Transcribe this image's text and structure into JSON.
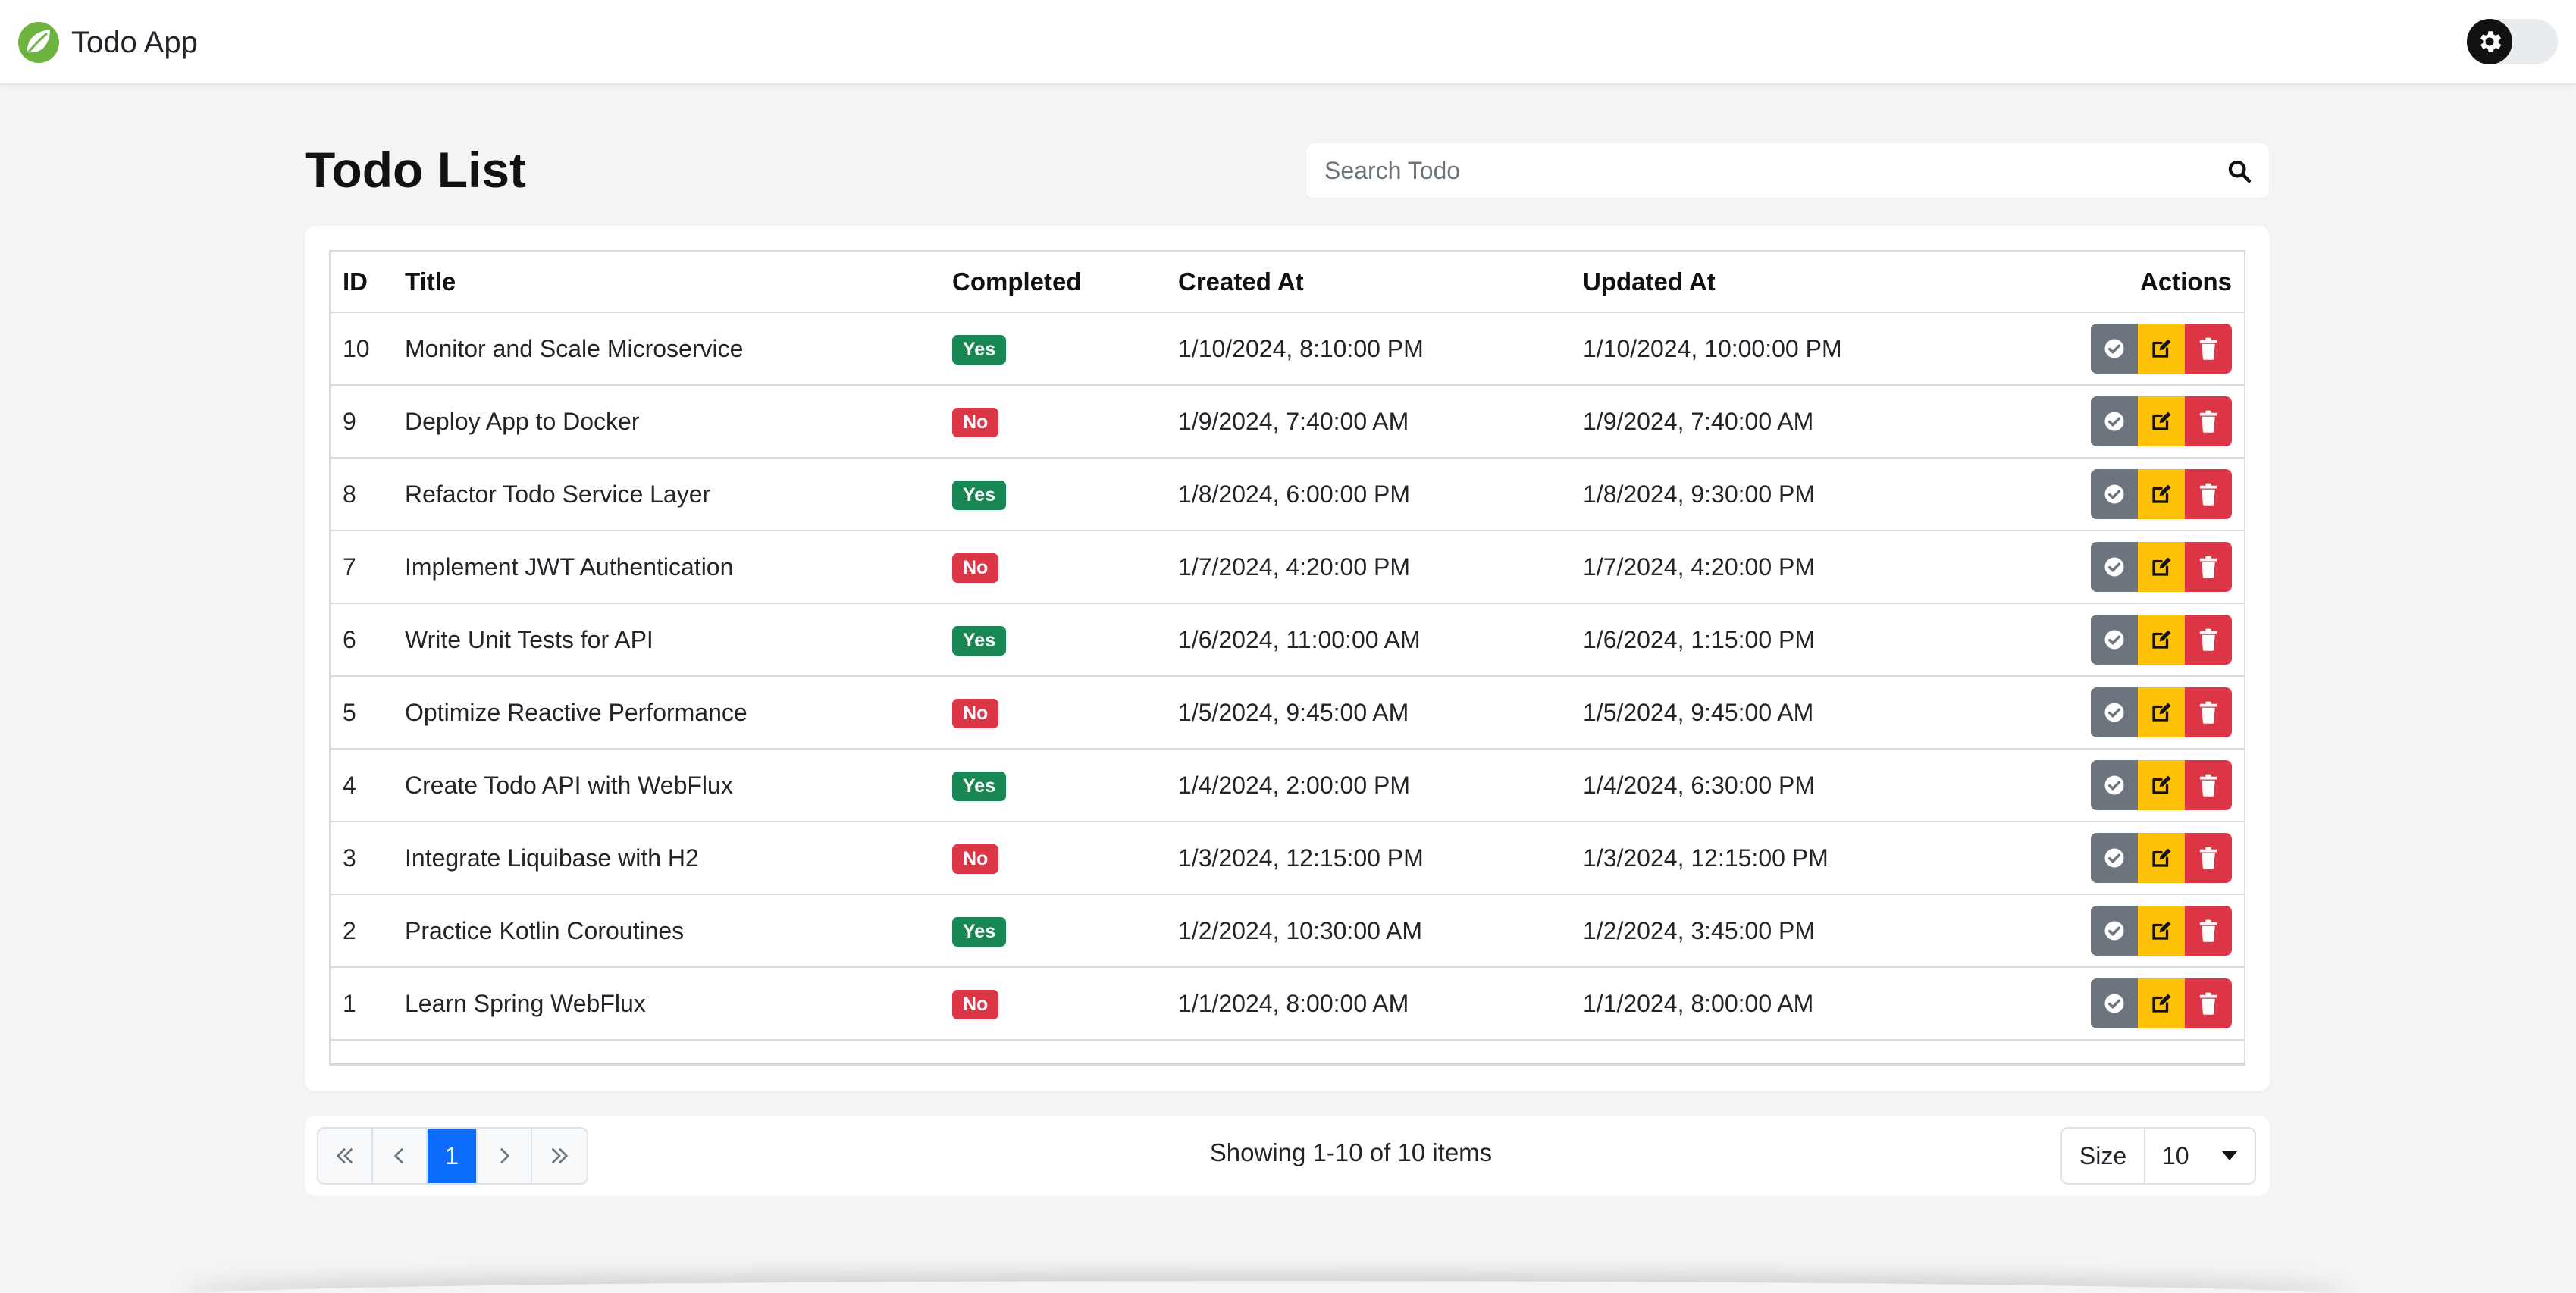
{
  "navbar": {
    "brand": "Todo App",
    "logo_icon": "spring-leaf-icon",
    "theme_icon": "gear-icon"
  },
  "page": {
    "title": "Todo List"
  },
  "search": {
    "placeholder": "Search Todo",
    "value": "",
    "icon": "search-icon"
  },
  "table": {
    "headers": {
      "id": "ID",
      "title": "Title",
      "completed": "Completed",
      "created": "Created At",
      "updated": "Updated At",
      "actions": "Actions"
    },
    "rows": [
      {
        "id": "10",
        "title": "Monitor and Scale Microservice",
        "completed": "Yes",
        "created": "1/10/2024, 8:10:00 PM",
        "updated": "1/10/2024, 10:00:00 PM"
      },
      {
        "id": "9",
        "title": "Deploy App to Docker",
        "completed": "No",
        "created": "1/9/2024, 7:40:00 AM",
        "updated": "1/9/2024, 7:40:00 AM"
      },
      {
        "id": "8",
        "title": "Refactor Todo Service Layer",
        "completed": "Yes",
        "created": "1/8/2024, 6:00:00 PM",
        "updated": "1/8/2024, 9:30:00 PM"
      },
      {
        "id": "7",
        "title": "Implement JWT Authentication",
        "completed": "No",
        "created": "1/7/2024, 4:20:00 PM",
        "updated": "1/7/2024, 4:20:00 PM"
      },
      {
        "id": "6",
        "title": "Write Unit Tests for API",
        "completed": "Yes",
        "created": "1/6/2024, 11:00:00 AM",
        "updated": "1/6/2024, 1:15:00 PM"
      },
      {
        "id": "5",
        "title": "Optimize Reactive Performance",
        "completed": "No",
        "created": "1/5/2024, 9:45:00 AM",
        "updated": "1/5/2024, 9:45:00 AM"
      },
      {
        "id": "4",
        "title": "Create Todo API with WebFlux",
        "completed": "Yes",
        "created": "1/4/2024, 2:00:00 PM",
        "updated": "1/4/2024, 6:30:00 PM"
      },
      {
        "id": "3",
        "title": "Integrate Liquibase with H2",
        "completed": "No",
        "created": "1/3/2024, 12:15:00 PM",
        "updated": "1/3/2024, 12:15:00 PM"
      },
      {
        "id": "2",
        "title": "Practice Kotlin Coroutines",
        "completed": "Yes",
        "created": "1/2/2024, 10:30:00 AM",
        "updated": "1/2/2024, 3:45:00 PM"
      },
      {
        "id": "1",
        "title": "Learn Spring WebFlux",
        "completed": "No",
        "created": "1/1/2024, 8:00:00 AM",
        "updated": "1/1/2024, 8:00:00 AM"
      }
    ]
  },
  "pagination": {
    "first_icon": "double-chevron-left-icon",
    "prev_icon": "chevron-left-icon",
    "current_page": "1",
    "next_icon": "chevron-right-icon",
    "last_icon": "double-chevron-right-icon",
    "showing": "Showing 1-10 of 10 items",
    "size_label": "Size",
    "size_value": "10"
  },
  "colors": {
    "accent": "#0d6efd",
    "success": "#198754",
    "danger": "#dc3545",
    "warning": "#ffc107",
    "secondary": "#6c757d"
  }
}
